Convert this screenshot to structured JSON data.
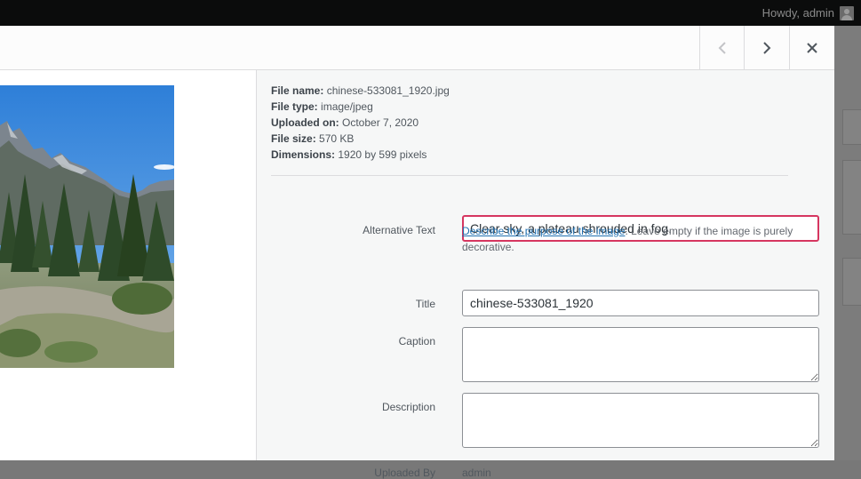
{
  "admin_bar": {
    "greeting": "Howdy, admin"
  },
  "modal": {
    "nav": {
      "prev_icon": "chevron-left-icon",
      "next_icon": "chevron-right-icon",
      "close_icon": "close-icon"
    }
  },
  "file_info": {
    "file_name_label": "File name:",
    "file_name": "chinese-533081_1920.jpg",
    "file_type_label": "File type:",
    "file_type": "image/jpeg",
    "uploaded_on_label": "Uploaded on:",
    "uploaded_on": "October 7, 2020",
    "file_size_label": "File size:",
    "file_size": "570 KB",
    "dimensions_label": "Dimensions:",
    "dimensions": "1920 by 599 pixels"
  },
  "fields": {
    "alt_text": {
      "label": "Alternative Text",
      "value": "Clear sky, a plateau shrouded in fog."
    },
    "alt_help": {
      "link": "Describe the purpose of the image",
      "text": ". Leave empty if the image is purely decorative."
    },
    "title": {
      "label": "Title",
      "value": "chinese-533081_1920"
    },
    "caption": {
      "label": "Caption",
      "value": ""
    },
    "description": {
      "label": "Description",
      "value": ""
    },
    "uploaded_by": {
      "label": "Uploaded By",
      "value": "admin"
    }
  },
  "colors": {
    "focus_border": "#d63660",
    "link": "#2271b1"
  }
}
